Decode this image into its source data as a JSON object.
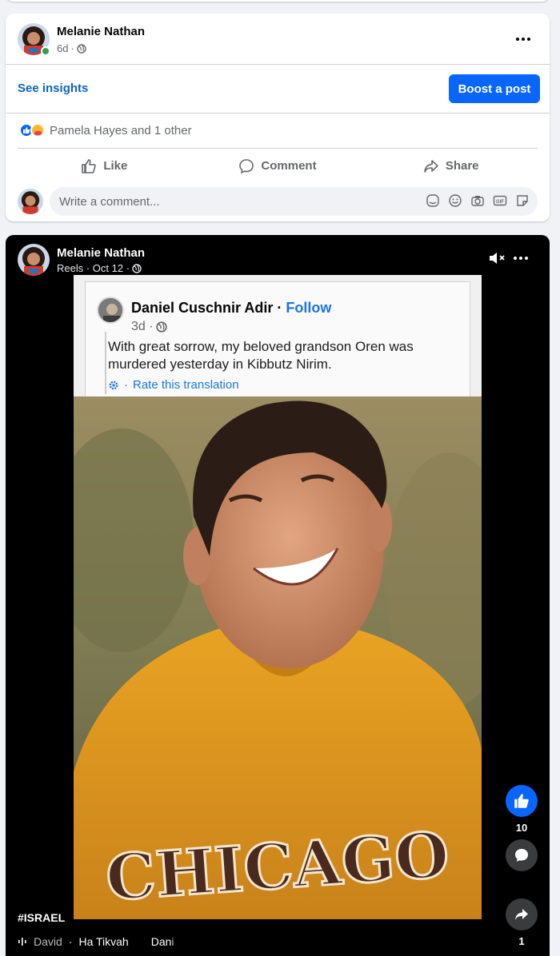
{
  "post1": {
    "author": "Melanie Nathan",
    "time": "6d",
    "separator": "·",
    "insights_label": "See insights",
    "boost_label": "Boost a post",
    "reactions_text": "Pamela Hayes and 1 other",
    "actions": {
      "like": "Like",
      "comment": "Comment",
      "share": "Share"
    },
    "comment_placeholder": "Write a comment...",
    "comment_tools": [
      "avatar-sticker-icon",
      "emoji-icon",
      "camera-icon",
      "gif-icon",
      "sticker-icon"
    ]
  },
  "reel": {
    "author": "Melanie Nathan",
    "meta": "Reels · Oct 12 ·",
    "screenshot": {
      "name": "Daniel Cuschnir Adir",
      "separator": " · ",
      "follow": "Follow",
      "time": "3d ·",
      "text": "With great sorrow, my beloved grandson Oren was murdered yesterday in Kibbutz Nirim.",
      "translate_prefix": "·",
      "translate": "Rate this translation"
    },
    "shirt_text": "CHICAGO",
    "like_count": "10",
    "share_count": "1",
    "hashtag": "#ISRAEL",
    "music_faded": "David",
    "music_separator": "·",
    "music_title": "Ha Tikvah",
    "music_next": "Dan",
    "music_next_faded": "i"
  },
  "colors": {
    "accent": "#0866ff",
    "link": "#0a66c2",
    "online": "#31a24c",
    "reel_bg": "#000000"
  }
}
